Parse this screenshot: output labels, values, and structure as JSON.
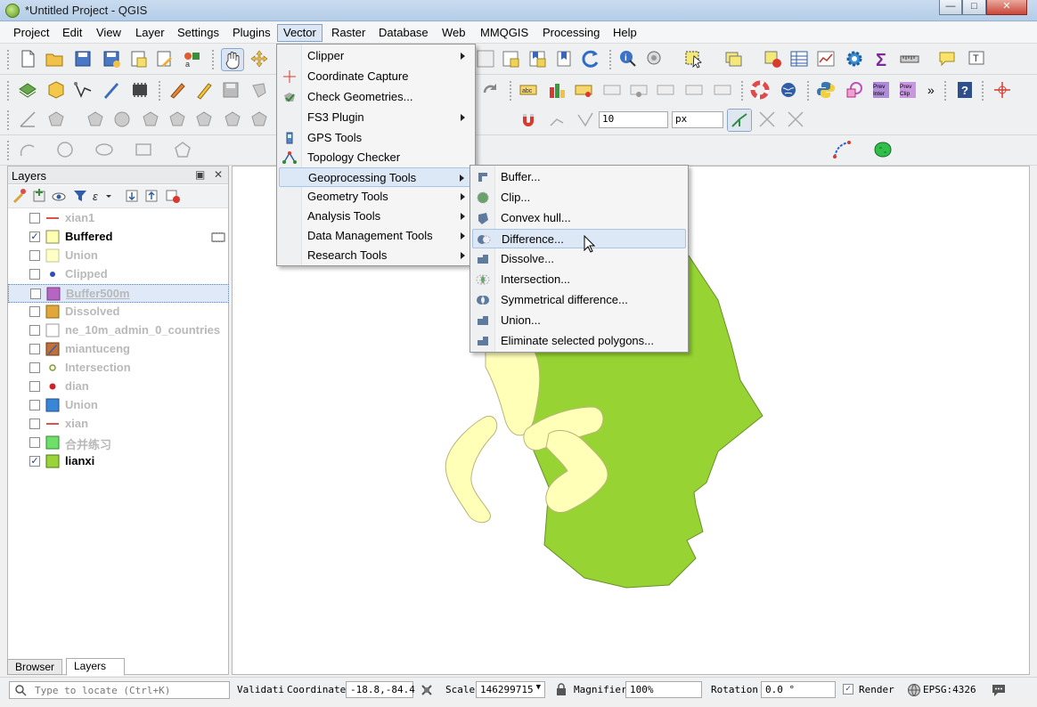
{
  "window": {
    "title": "*Untitled Project - QGIS",
    "controls": [
      "minimize-icon",
      "maximize-icon",
      "close-icon"
    ]
  },
  "menubar": {
    "items": [
      {
        "label": "Project"
      },
      {
        "label": "Edit"
      },
      {
        "label": "View"
      },
      {
        "label": "Layer"
      },
      {
        "label": "Settings"
      },
      {
        "label": "Plugins"
      },
      {
        "label": "Vector"
      },
      {
        "label": "Raster"
      },
      {
        "label": "Database"
      },
      {
        "label": "Web"
      },
      {
        "label": "MMQGIS"
      },
      {
        "label": "Processing"
      },
      {
        "label": "Help"
      }
    ]
  },
  "toolbar_inputs": {
    "snap_tolerance": "10",
    "snap_unit": "px"
  },
  "vector_menu": {
    "items": [
      {
        "label": "Clipper",
        "submenu": true
      },
      {
        "label": "Coordinate Capture",
        "submenu": false
      },
      {
        "label": "Check Geometries...",
        "submenu": false
      },
      {
        "label": "FS3 Plugin",
        "submenu": true
      },
      {
        "label": "GPS Tools",
        "submenu": false
      },
      {
        "label": "Topology Checker",
        "submenu": false
      },
      {
        "label": "Geoprocessing Tools",
        "submenu": true
      },
      {
        "label": "Geometry Tools",
        "submenu": true
      },
      {
        "label": "Analysis Tools",
        "submenu": true
      },
      {
        "label": "Data Management Tools",
        "submenu": true
      },
      {
        "label": "Research Tools",
        "submenu": true
      }
    ]
  },
  "geoprocessing_menu": {
    "items": [
      {
        "label": "Buffer..."
      },
      {
        "label": "Clip..."
      },
      {
        "label": "Convex hull..."
      },
      {
        "label": "Difference..."
      },
      {
        "label": "Dissolve..."
      },
      {
        "label": "Intersection..."
      },
      {
        "label": "Symmetrical difference..."
      },
      {
        "label": "Union..."
      },
      {
        "label": "Eliminate selected polygons..."
      }
    ]
  },
  "layers_panel": {
    "title": "Layers",
    "layers": [
      {
        "name": "xian1",
        "checked": false,
        "symbol": "line",
        "color": "#d9534f"
      },
      {
        "name": "Buffered",
        "checked": true,
        "symbol": "fill",
        "color": "#ffffb3"
      },
      {
        "name": "Union",
        "checked": false,
        "symbol": "fill",
        "color": "#ffffc6"
      },
      {
        "name": "Clipped",
        "checked": false,
        "symbol": "point",
        "color": "#2c4fb0"
      },
      {
        "name": "Buffer500m",
        "checked": false,
        "symbol": "fill",
        "color": "#b466c1"
      },
      {
        "name": "Dissolved",
        "checked": false,
        "symbol": "fill",
        "color": "#e2a63a"
      },
      {
        "name": "ne_10m_admin_0_countries",
        "checked": false,
        "symbol": "fill",
        "color": "#ffffff"
      },
      {
        "name": "miantuceng",
        "checked": false,
        "symbol": "raster",
        "color": "#c0703a"
      },
      {
        "name": "Intersection",
        "checked": false,
        "symbol": "ring",
        "color": "#7f9b2a"
      },
      {
        "name": "dian",
        "checked": false,
        "symbol": "point",
        "color": "#d0202a"
      },
      {
        "name": "Union",
        "checked": false,
        "symbol": "fill",
        "color": "#3a86d6"
      },
      {
        "name": "xian",
        "checked": false,
        "symbol": "line",
        "color": "#d9534f"
      },
      {
        "name": "合并练习",
        "checked": false,
        "symbol": "fill",
        "color": "#6ee06a"
      },
      {
        "name": "lianxi",
        "checked": true,
        "symbol": "fill",
        "color": "#9bd43a"
      }
    ],
    "tabs": [
      "Browser",
      "Layers"
    ]
  },
  "statusbar": {
    "locator_placeholder": "Type to locate (Ctrl+K)",
    "validate_label": "Validati",
    "coordinate_label": "Coordinate",
    "coordinate_value": "-18.8,-84.4",
    "scale_label": "Scale",
    "scale_value": "146299715",
    "magnifier_label": "Magnifier",
    "magnifier_value": "100%",
    "rotation_label": "Rotation",
    "rotation_value": "0.0 °",
    "render_label": "Render",
    "render_checked": true,
    "crs_label": "EPSG:4326"
  },
  "colors": {
    "polygon_fill": "#97d433",
    "buffer_fill": "#ffffb8",
    "menu_highlight": "#dde8f7"
  }
}
